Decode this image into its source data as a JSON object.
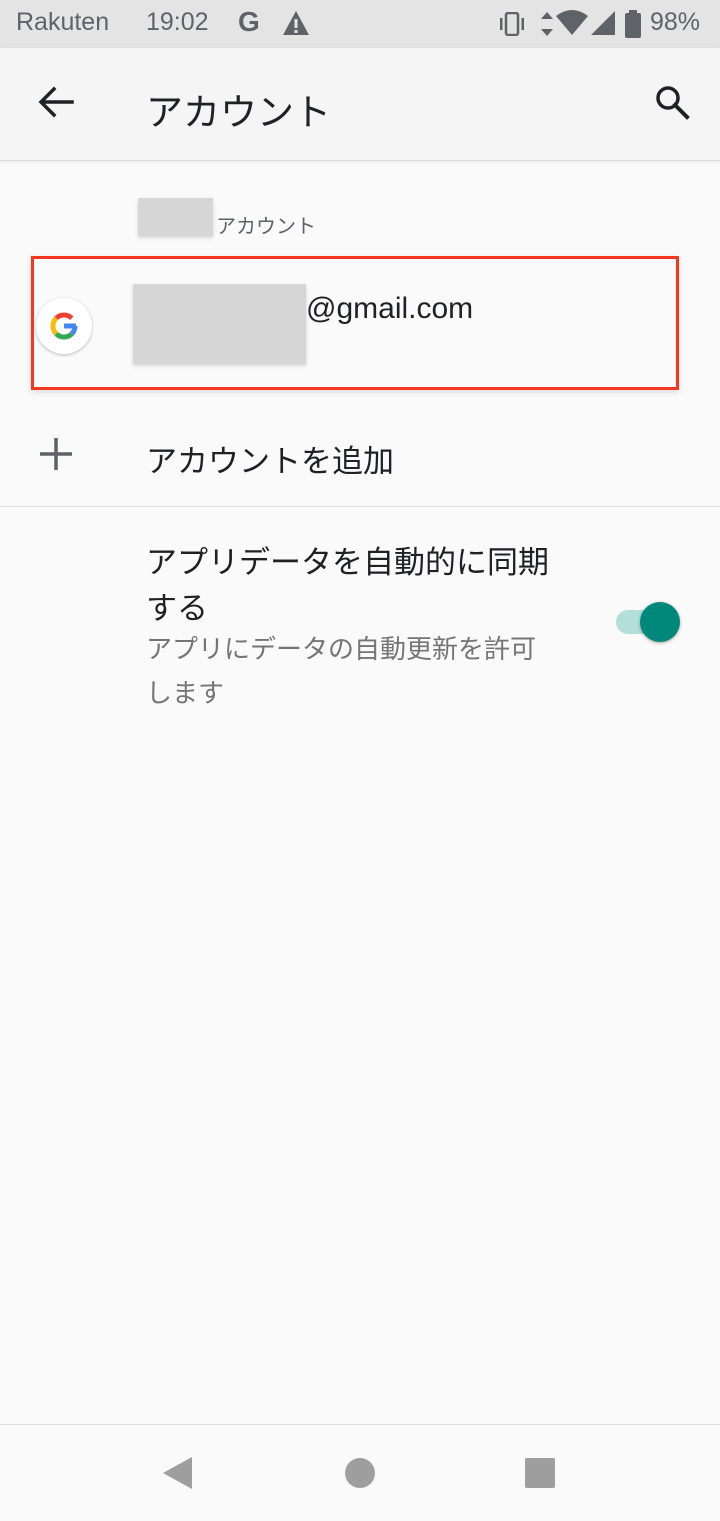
{
  "status_bar": {
    "carrier": "Rakuten",
    "time": "19:02",
    "google_glyph": "G",
    "battery": "98%",
    "icons": [
      "google-icon",
      "warning-icon",
      "vibrate-icon",
      "data-arrows-icon",
      "wifi-icon",
      "signal-icon",
      "battery-icon"
    ]
  },
  "app_bar": {
    "title": "アカウント",
    "back_icon": "arrow-left-icon",
    "search_icon": "search-icon"
  },
  "account_section": {
    "header_suffix": "アカウント",
    "account": {
      "email_suffix": "@gmail.com",
      "provider_icon": "google-icon",
      "highlight_color": "#f4381f"
    }
  },
  "add_account": {
    "label": "アカウントを追加",
    "icon": "plus-icon"
  },
  "sync": {
    "title": "アプリデータを自動的に同期する",
    "summary": "アプリにデータの自動更新を許可します",
    "enabled": true,
    "accent_color": "#00897b"
  },
  "nav_bar": {
    "icons": [
      "nav-back-icon",
      "nav-home-icon",
      "nav-recents-icon"
    ]
  }
}
